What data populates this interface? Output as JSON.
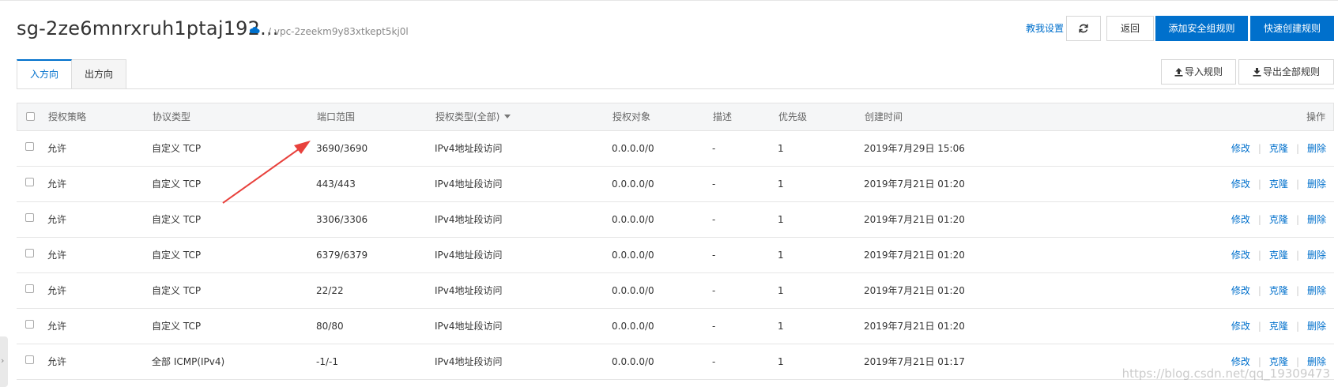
{
  "header": {
    "title": "sg-2ze6mnrxruh1ptaj192...",
    "cloud_icon": "cloud-icon",
    "vpc_label": "/ vpc-2zeekm9y83xtkept5kj0l",
    "tutorial_link": "教我设置",
    "refresh_icon": "refresh-icon",
    "back_button": "返回",
    "add_rule_button": "添加安全组规则",
    "quick_create_button": "快速创建规则",
    "accent_color": "#0070cc"
  },
  "tabs": [
    {
      "label": "入方向",
      "active": true
    },
    {
      "label": "出方向",
      "active": false
    }
  ],
  "toolbar": {
    "import_label": "导入规则",
    "export_label": "导出全部规则"
  },
  "table": {
    "columns": {
      "policy": "授权策略",
      "protocol": "协议类型",
      "port": "端口范围",
      "auth_type": "授权类型(全部)",
      "object": "授权对象",
      "desc": "描述",
      "priority": "优先级",
      "created": "创建时间",
      "ops": "操作"
    },
    "actions": {
      "edit": "修改",
      "clone": "克隆",
      "delete": "删除"
    },
    "rows": [
      {
        "policy": "允许",
        "protocol": "自定义 TCP",
        "port": "3690/3690",
        "auth_type": "IPv4地址段访问",
        "object": "0.0.0.0/0",
        "desc": "-",
        "priority": "1",
        "created": "2019年7月29日 15:06"
      },
      {
        "policy": "允许",
        "protocol": "自定义 TCP",
        "port": "443/443",
        "auth_type": "IPv4地址段访问",
        "object": "0.0.0.0/0",
        "desc": "-",
        "priority": "1",
        "created": "2019年7月21日 01:20"
      },
      {
        "policy": "允许",
        "protocol": "自定义 TCP",
        "port": "3306/3306",
        "auth_type": "IPv4地址段访问",
        "object": "0.0.0.0/0",
        "desc": "-",
        "priority": "1",
        "created": "2019年7月21日 01:20"
      },
      {
        "policy": "允许",
        "protocol": "自定义 TCP",
        "port": "6379/6379",
        "auth_type": "IPv4地址段访问",
        "object": "0.0.0.0/0",
        "desc": "-",
        "priority": "1",
        "created": "2019年7月21日 01:20"
      },
      {
        "policy": "允许",
        "protocol": "自定义 TCP",
        "port": "22/22",
        "auth_type": "IPv4地址段访问",
        "object": "0.0.0.0/0",
        "desc": "-",
        "priority": "1",
        "created": "2019年7月21日 01:20"
      },
      {
        "policy": "允许",
        "protocol": "自定义 TCP",
        "port": "80/80",
        "auth_type": "IPv4地址段访问",
        "object": "0.0.0.0/0",
        "desc": "-",
        "priority": "1",
        "created": "2019年7月21日 01:20"
      },
      {
        "policy": "允许",
        "protocol": "全部 ICMP(IPv4)",
        "port": "-1/-1",
        "auth_type": "IPv4地址段访问",
        "object": "0.0.0.0/0",
        "desc": "-",
        "priority": "1",
        "created": "2019年7月21日 01:17"
      }
    ]
  },
  "annotation": {
    "arrow_color": "#e8413c"
  },
  "watermark": "https://blog.csdn.net/qq_19309473"
}
